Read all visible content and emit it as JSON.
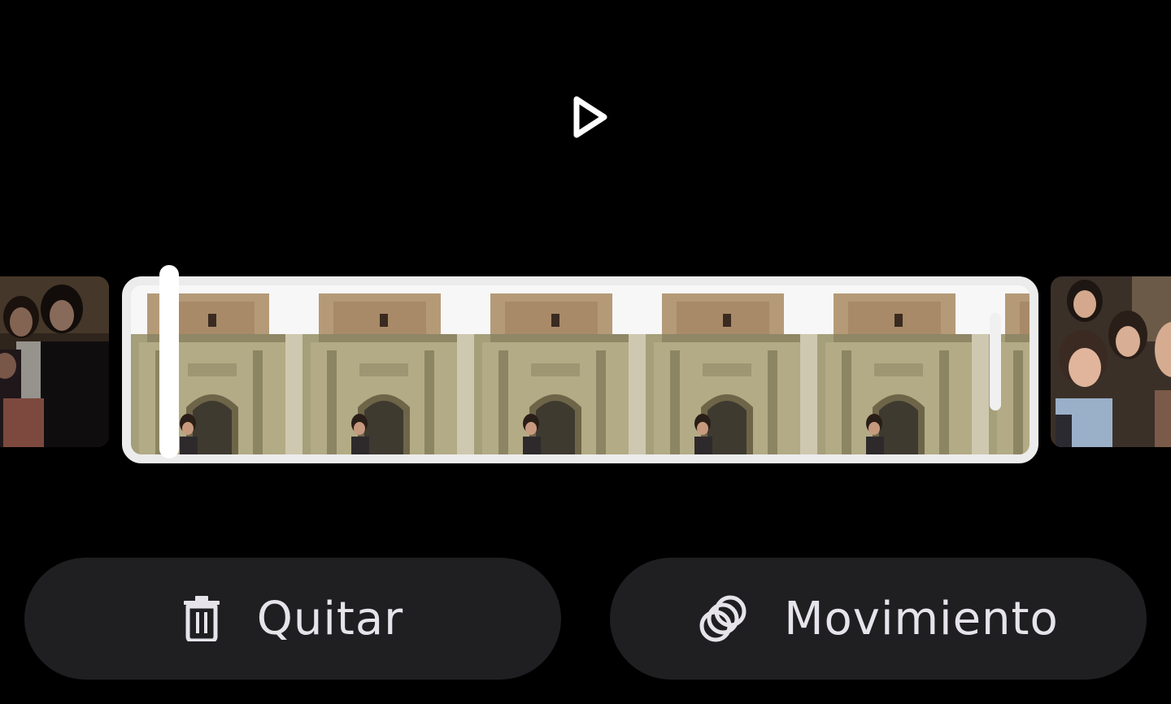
{
  "player": {
    "play_icon": "play-icon"
  },
  "timeline": {
    "clips": [
      {
        "name": "previous-clip",
        "selected": false
      },
      {
        "name": "current-clip",
        "selected": true
      },
      {
        "name": "next-clip",
        "selected": false
      }
    ],
    "selected_border_color": "#ececec"
  },
  "actions": {
    "remove": {
      "label": "Quitar",
      "icon": "trash-icon"
    },
    "motion": {
      "label": "Movimiento",
      "icon": "motion-circles-icon"
    }
  },
  "colors": {
    "background": "#000000",
    "button_bg": "#1f1f22",
    "button_text": "#e6e4ea"
  }
}
